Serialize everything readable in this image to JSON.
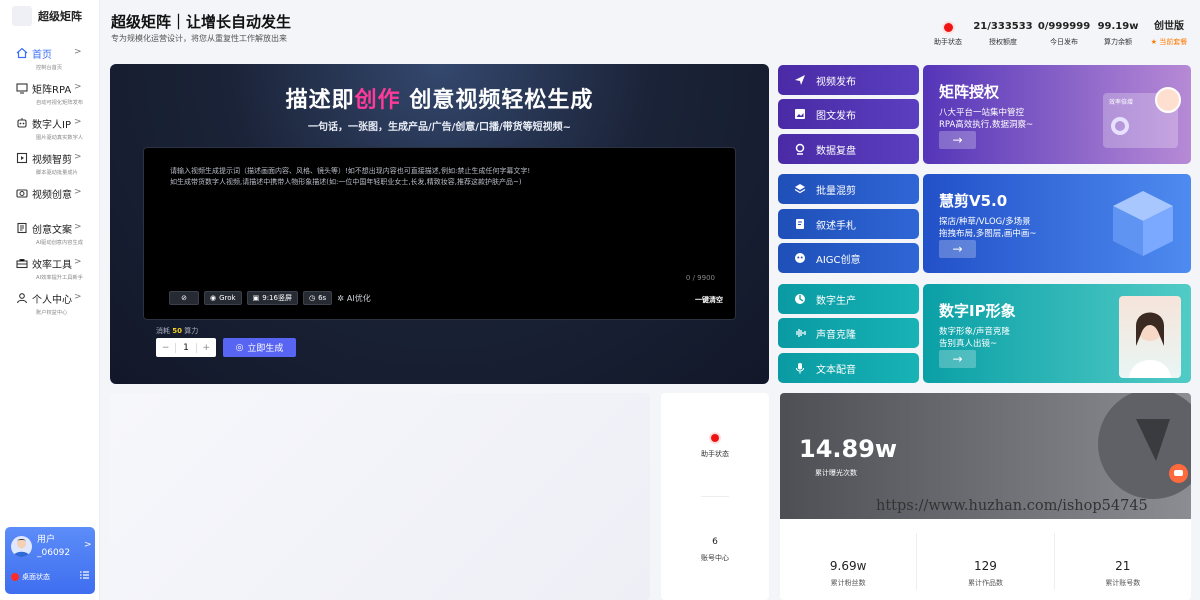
{
  "app": {
    "name": "超级矩阵"
  },
  "sidebar": {
    "items": [
      {
        "label": "首页",
        "sub": "控制台首页",
        "icon": "home-icon"
      },
      {
        "label": "矩阵RPA",
        "sub": "自动可视化矩阵发布",
        "icon": "rpa-icon"
      },
      {
        "label": "数字人IP",
        "sub": "图片驱动真实数字人",
        "icon": "robot-icon"
      },
      {
        "label": "视频智剪",
        "sub": "脚本驱动批量成片",
        "icon": "video-edit-icon"
      },
      {
        "label": "视频创意",
        "sub": "",
        "icon": "camera-icon"
      },
      {
        "label": "创意文案",
        "sub": "AI驱动创意内容生成",
        "icon": "copywriting-icon"
      },
      {
        "label": "效率工具",
        "sub": "AI效率提升工具新手",
        "icon": "toolbox-icon"
      },
      {
        "label": "个人中心",
        "sub": "账户权益中心",
        "icon": "user-icon"
      }
    ],
    "user": {
      "name": "用户_06092",
      "status": "桌面状态"
    }
  },
  "header": {
    "title": "超级矩阵｜让增长自动发生",
    "subtitle": "专为规模化运营设计，将您从重复性工作解放出来",
    "stats": [
      {
        "value": "",
        "label": "助手状态",
        "dot": true
      },
      {
        "value": "21/333533",
        "label": "授权额度"
      },
      {
        "value": "0/999999",
        "label": "今日发布"
      },
      {
        "value": "99.19w",
        "label": "算力余额"
      },
      {
        "value": "创世版",
        "label": "当前套餐"
      }
    ]
  },
  "hero": {
    "title_pre": "描述即",
    "title_hl": "创作",
    "title_post": " 创意视频轻松生成",
    "subtitle": "一句话，一张图，生成产品/广告/创意/口播/带货等短视频~",
    "prompt_line1": "请输入视频生成提示词（描述画面内容、风格、镜头等）!如不想出现内容也可直接描述,例如:禁止生成任何字幕文字!",
    "prompt_line2": "如生成带货数字人视频,请描述中携带人物形象描述(如:一位中国年轻职业女士,长发,精致妆容,推荐这款护肤产品~)",
    "counter": "0 / 9900",
    "tools": {
      "model": "Grok",
      "ratio": "9:16竖屏",
      "duration": "6s",
      "ai": "AI优化"
    },
    "clear": "一键清空",
    "cost_pre": "消耗",
    "cost_val": "50",
    "cost_post": "算力",
    "quantity": "1",
    "generate": "立即生成"
  },
  "quick": [
    {
      "label": "视频发布",
      "icon": "send-icon"
    },
    {
      "label": "图文发布",
      "icon": "image-icon"
    },
    {
      "label": "数据复盘",
      "icon": "data-icon"
    },
    {
      "label": "批量混剪",
      "icon": "layers-icon"
    },
    {
      "label": "叙述手札",
      "icon": "note-icon"
    },
    {
      "label": "AIGC创意",
      "icon": "aigc-icon"
    },
    {
      "label": "数字生产",
      "icon": "digital-icon"
    },
    {
      "label": "声音克隆",
      "icon": "waveform-icon"
    },
    {
      "label": "文本配音",
      "icon": "mic-icon"
    }
  ],
  "cards": [
    {
      "title": "矩阵授权",
      "l1": "八大平台一站集中管控",
      "l2": "RPA高效执行,数据洞察~",
      "badge": "效率倍增"
    },
    {
      "title": "慧剪V5.0",
      "l1": "探店/种草/VLOG/多场景",
      "l2": "拖拽布局,多图层,画中画~"
    },
    {
      "title": "数字IP形象",
      "l1": "数字形象/声音克隆",
      "l2": "告别真人出镜~"
    }
  ],
  "assistant": {
    "status_label": "助手状态",
    "account_count": "6",
    "account_label": "账号中心"
  },
  "stats_card": {
    "big": "14.89w",
    "big_label": "累计曝光次数",
    "cols": [
      {
        "value": "9.69w",
        "label": "累计粉丝数"
      },
      {
        "value": "129",
        "label": "累计作品数"
      },
      {
        "value": "21",
        "label": "累计账号数"
      }
    ]
  },
  "watermark": "https://www.huzhan.com/ishop54745",
  "colors": {
    "accent": "#3b6ff5",
    "purple": "#4a2aa5",
    "blue": "#1f4fb8",
    "teal": "#0a9aa3",
    "status_red": "#f01313"
  }
}
